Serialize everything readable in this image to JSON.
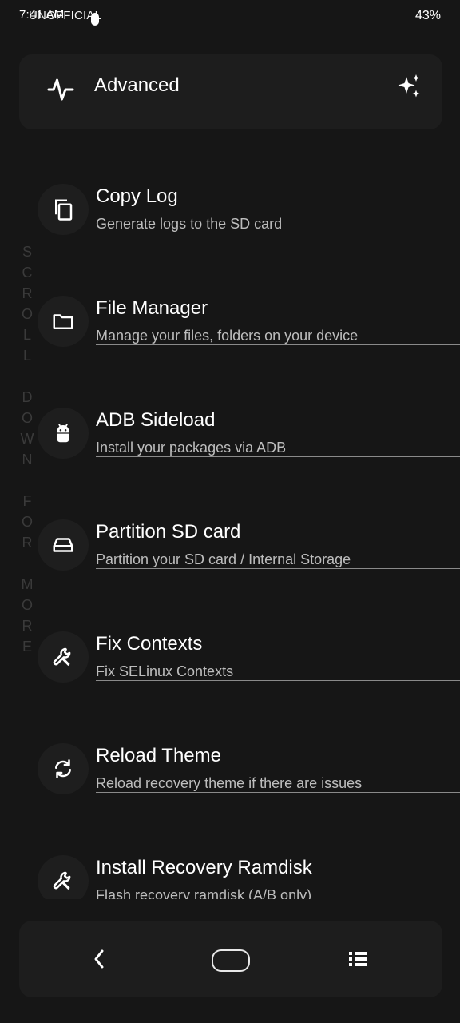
{
  "status_bar": {
    "time": "7:41 AM",
    "brand": "UNOFFICIAL",
    "battery": "43%"
  },
  "header": {
    "title": "Advanced",
    "left_icon": "pulse-icon",
    "right_icon": "sparkle-icon"
  },
  "side_hint": "S\nC\nR\nO\nL\nL\n\nD\nO\nW\nN\n\nF\nO\nR\n\nM\nO\nR\nE",
  "items": [
    {
      "title": "Copy Log",
      "subtitle": "Generate logs to the SD card",
      "icon": "copy-icon"
    },
    {
      "title": "File Manager",
      "subtitle": "Manage your files, folders on your device",
      "icon": "folder-icon"
    },
    {
      "title": "ADB Sideload",
      "subtitle": "Install your packages via ADB",
      "icon": "android-icon"
    },
    {
      "title": "Partition SD card",
      "subtitle": "Partition your SD card / Internal Storage",
      "icon": "storage-icon"
    },
    {
      "title": "Fix Contexts",
      "subtitle": "Fix SELinux Contexts",
      "icon": "wrench-icon"
    },
    {
      "title": "Reload Theme",
      "subtitle": "Reload recovery theme if there are issues",
      "icon": "reload-icon"
    },
    {
      "title": "Install Recovery Ramdisk",
      "subtitle": "Flash recovery ramdisk (A/B only)",
      "icon": "wrench-icon"
    }
  ],
  "navigation": {
    "back_icon": "chevron-left-icon",
    "home_icon": "home-pill-icon",
    "menu_icon": "list-icon"
  },
  "colors": {
    "background": "#161616",
    "card": "#1d1d1d",
    "text": "#ffffff",
    "subtext": "#bdbdbd",
    "divider": "#8a8a8a"
  }
}
